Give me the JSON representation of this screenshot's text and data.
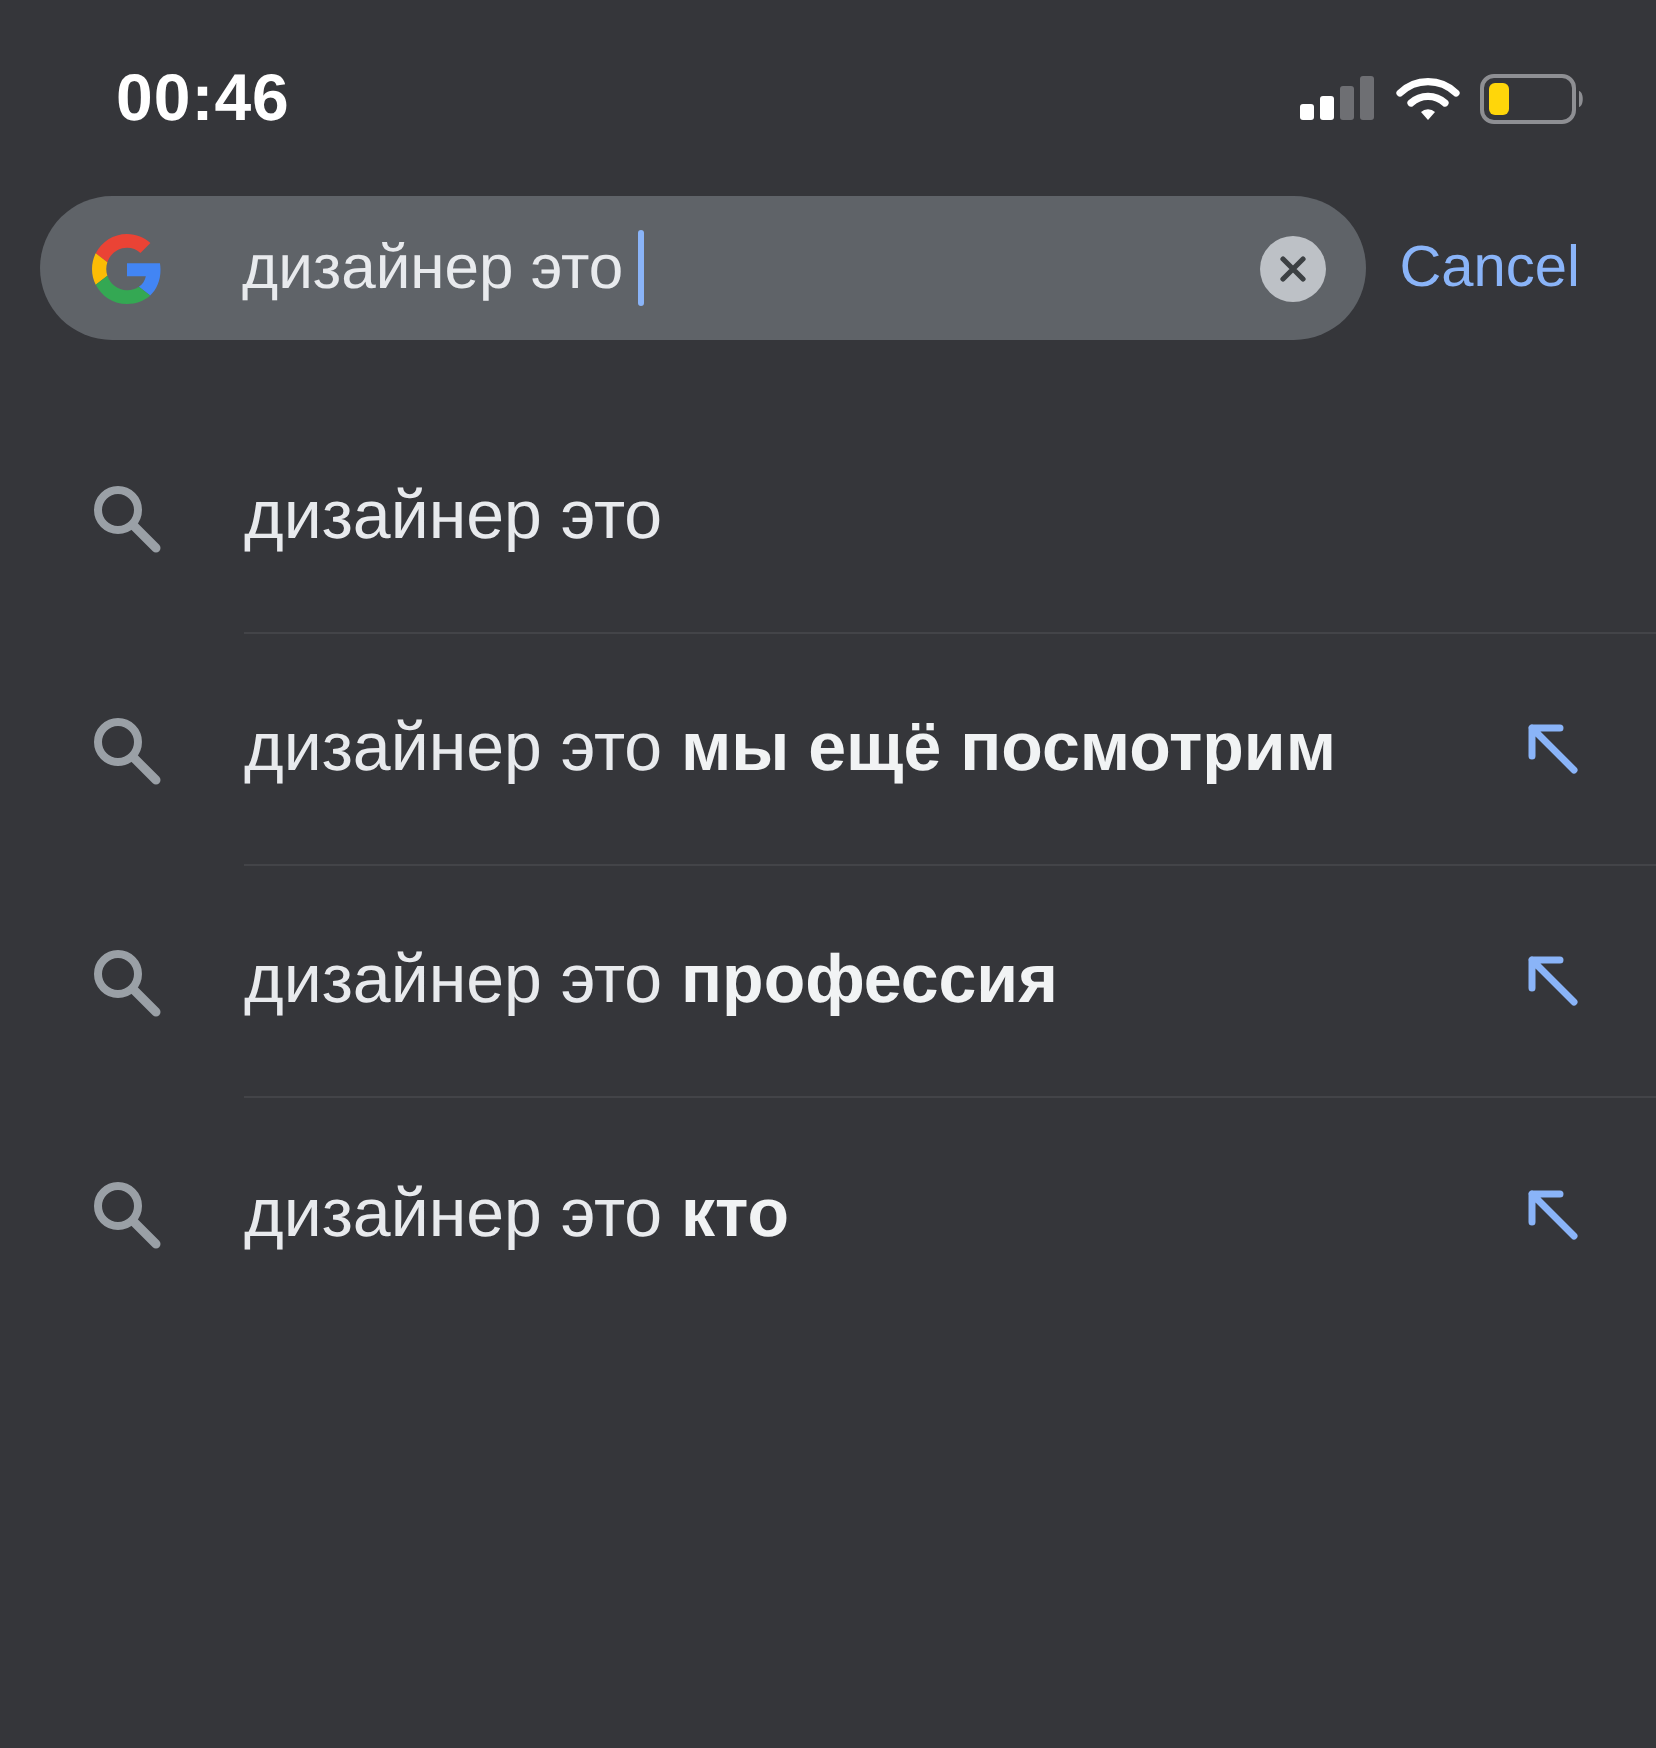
{
  "status_bar": {
    "time": "00:46"
  },
  "search": {
    "value": "дизайнер это",
    "cancel": "Cancel"
  },
  "suggestions": [
    {
      "kind": "plain",
      "text": "дизайнер это"
    },
    {
      "kind": "completion",
      "text": "дизайнер это **мы ещё посмотрим**"
    },
    {
      "kind": "completion",
      "text": "дизайнер это **профессия**"
    },
    {
      "kind": "completion",
      "text": "дизайнер это **кто**"
    }
  ]
}
